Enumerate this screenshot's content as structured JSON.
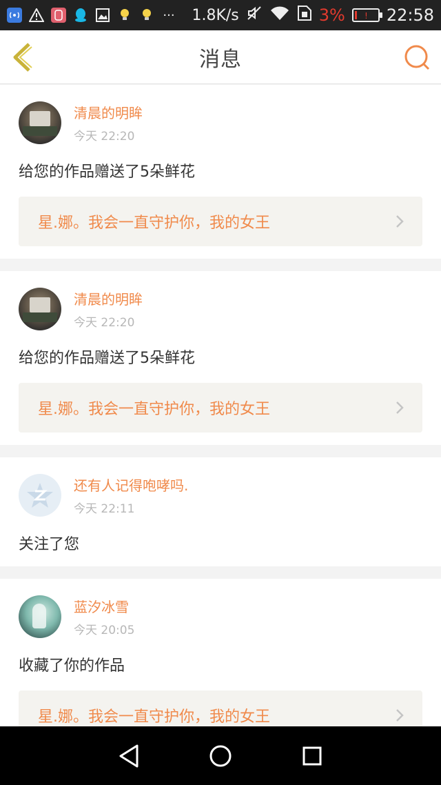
{
  "status_bar": {
    "net_speed": "1.8K/s",
    "battery_percent": "3%",
    "time": "22:58",
    "icons": [
      "wifi-hotspot-icon",
      "warning-icon",
      "app-icon",
      "qq-icon",
      "image-icon",
      "bulb-icon",
      "bulb-icon",
      "more-dots-icon",
      "mute-icon",
      "wifi-icon",
      "sim-icon",
      "battery-icon"
    ],
    "colors": {
      "background": "#222222",
      "battery_low": "#e23a2e"
    }
  },
  "header": {
    "title": "消息",
    "accent_color": "#f08a4b"
  },
  "messages": [
    {
      "username": "清晨的明眸",
      "time": "今天 22:20",
      "action": "给您的作品赠送了5朵鲜花",
      "work_title": "星.娜。我会一直守护你，我的女王",
      "avatar": "ship"
    },
    {
      "username": "清晨的明眸",
      "time": "今天 22:20",
      "action": "给您的作品赠送了5朵鲜花",
      "work_title": "星.娜。我会一直守护你，我的女王",
      "avatar": "ship"
    },
    {
      "username": "还有人记得咆哮吗.",
      "time": "今天 22:11",
      "action": "关注了您",
      "avatar": "default-q"
    },
    {
      "username": "蓝汐冰雪",
      "time": "今天 20:05",
      "action": "收藏了你的作品",
      "work_title": "星.娜。我会一直守护你，我的女王",
      "avatar": "anime"
    }
  ],
  "nav_bar": {
    "buttons": [
      "back-triangle-icon",
      "home-circle-icon",
      "recents-square-icon"
    ]
  }
}
